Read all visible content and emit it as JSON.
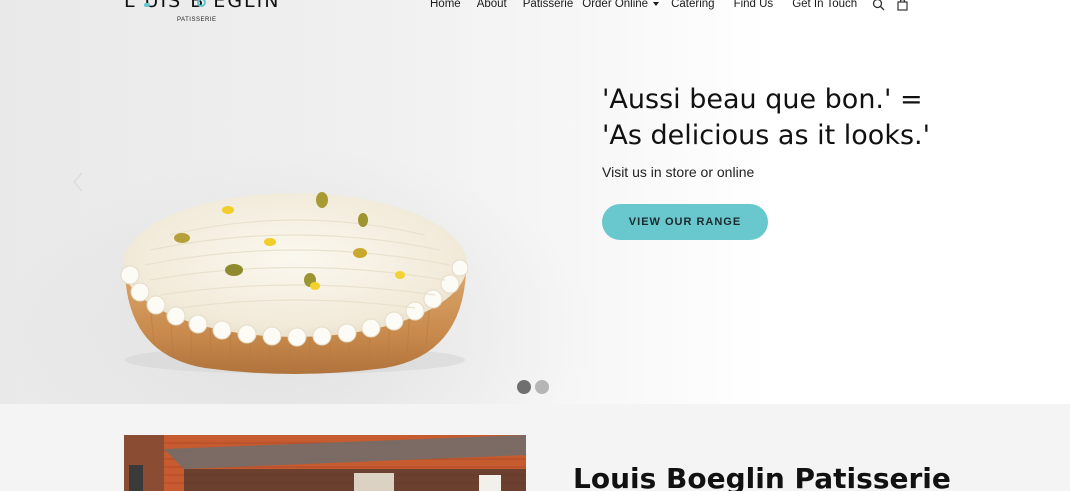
{
  "brand": {
    "name": "L  UIS B  EGLIN",
    "subtitle": "PATISSERIE",
    "accent_color": "#69c7ce"
  },
  "nav": {
    "items": [
      {
        "label": "Home"
      },
      {
        "label": "About"
      },
      {
        "label": "Patisserie"
      },
      {
        "label": "Order Online",
        "dropdown": true
      },
      {
        "label": "Catering"
      },
      {
        "label": "Find Us"
      },
      {
        "label": "Get In Touch"
      }
    ],
    "icons": [
      "search-icon",
      "cart-bag-icon"
    ]
  },
  "hero": {
    "title_line1": "'Aussi beau que bon.' =",
    "title_line2": "'As delicious as it looks.'",
    "subtitle": "Visit us in store or online",
    "button_label": "VIEW OUR RANGE",
    "slides": [
      {
        "active": true,
        "color": "#6f6f6f"
      },
      {
        "active": false,
        "color": "#b5b5b5"
      }
    ]
  },
  "about": {
    "title": "Louis Boeglin Patisserie"
  }
}
